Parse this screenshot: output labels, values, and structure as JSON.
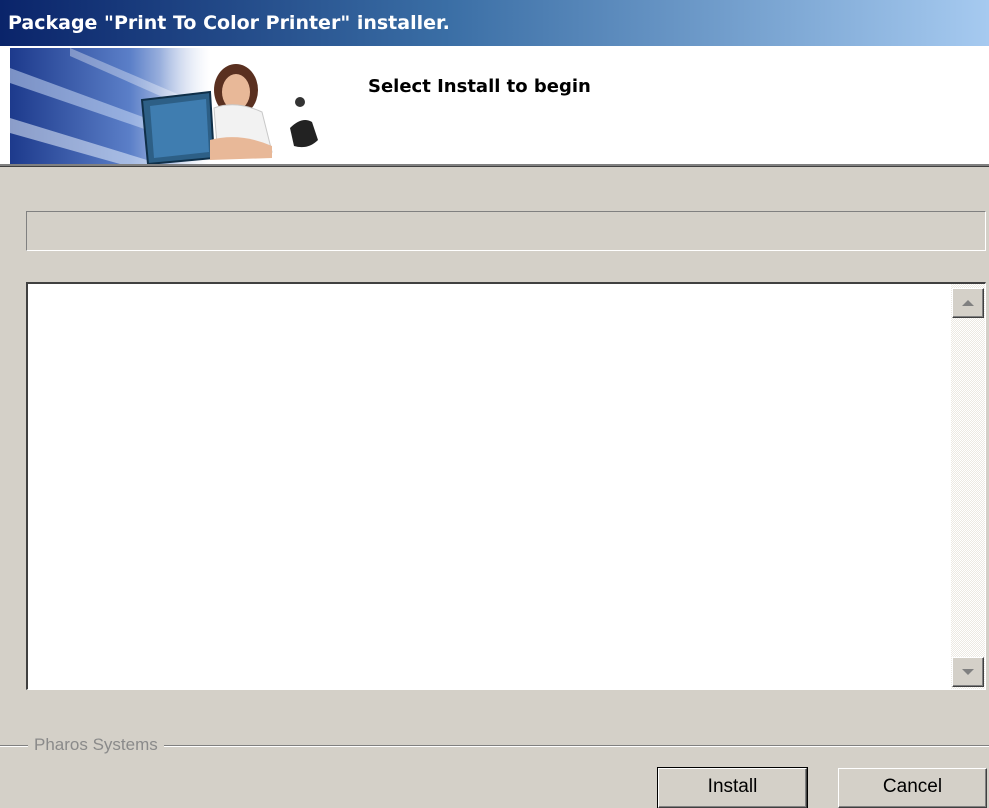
{
  "window": {
    "title": "Package \"Print To Color Printer\" installer."
  },
  "banner": {
    "instruction": "Select Install to begin",
    "image_icon": "woman-with-laptop-banner-image"
  },
  "progress": {
    "value_percent": 0
  },
  "log": {
    "text": ""
  },
  "footer": {
    "group_label": "Pharos Systems",
    "install_label": "Install",
    "cancel_label": "Cancel"
  },
  "colors": {
    "titlebar_start": "#0a246a",
    "titlebar_end": "#a6caf0",
    "dialog_bg": "#d4d0c8"
  }
}
